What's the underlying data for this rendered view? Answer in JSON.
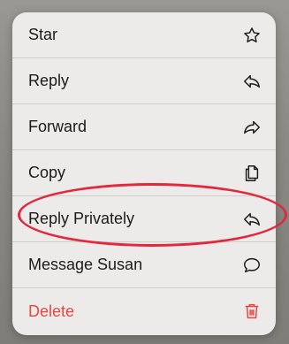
{
  "menu": {
    "items": [
      {
        "label": "Star",
        "icon": "star-icon"
      },
      {
        "label": "Reply",
        "icon": "reply-icon"
      },
      {
        "label": "Forward",
        "icon": "forward-icon"
      },
      {
        "label": "Copy",
        "icon": "copy-icon"
      },
      {
        "label": "Reply Privately",
        "icon": "reply-private-icon"
      },
      {
        "label": "Message Susan",
        "icon": "chat-bubble-icon"
      },
      {
        "label": "Delete",
        "icon": "trash-icon"
      }
    ]
  },
  "colors": {
    "menu_bg": "#ecebe9",
    "text": "#1b1b1b",
    "danger": "#e8473f",
    "highlight_circle": "#e3273d"
  }
}
